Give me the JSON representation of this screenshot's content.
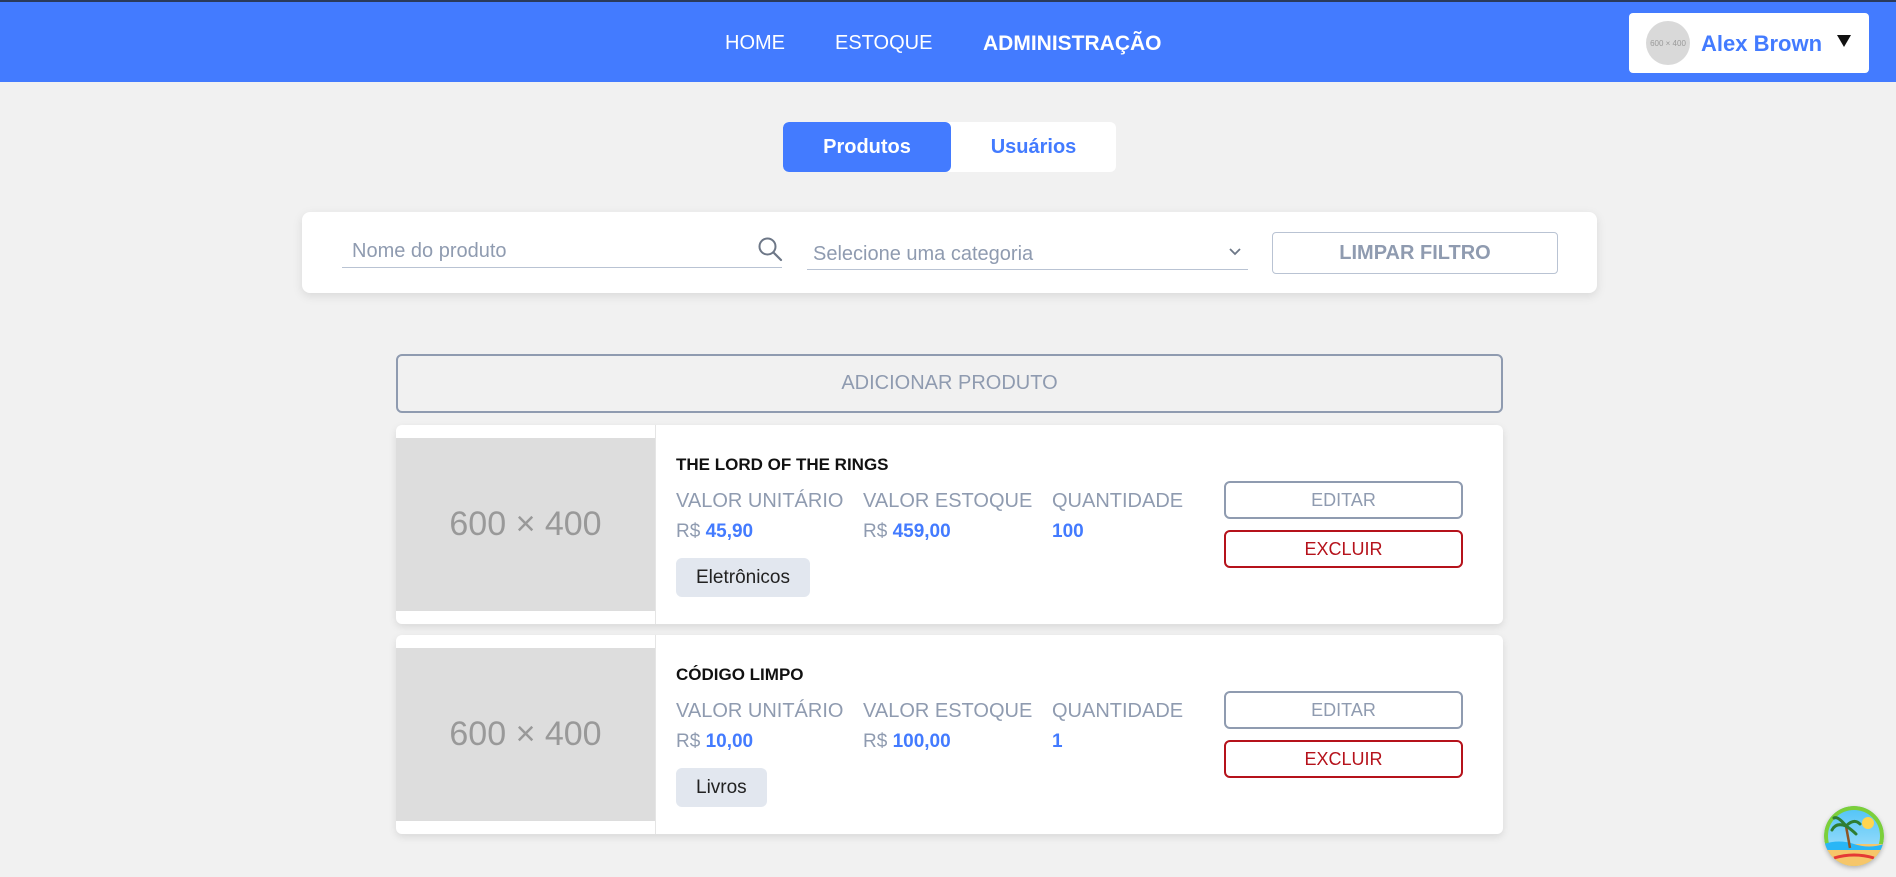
{
  "nav": {
    "links": [
      {
        "label": "HOME"
      },
      {
        "label": "ESTOQUE"
      },
      {
        "label": "ADMINISTRAÇÃO",
        "active": true
      }
    ]
  },
  "user": {
    "name": "Alex Brown",
    "avatar_placeholder": "600 × 400"
  },
  "tabs": [
    {
      "label": "Produtos",
      "active": true
    },
    {
      "label": "Usuários",
      "active": false
    }
  ],
  "filters": {
    "search_placeholder": "Nome do produto",
    "search_value": "",
    "category_placeholder": "Selecione uma categoria",
    "clear_label": "LIMPAR FILTRO"
  },
  "add_product_label": "ADICIONAR PRODUTO",
  "product_labels": {
    "unit_value": "VALOR UNITÁRIO",
    "stock_value": "VALOR ESTOQUE",
    "quantity": "QUANTIDADE",
    "currency": "R$",
    "edit": "EDITAR",
    "delete": "EXCLUIR"
  },
  "products": [
    {
      "image_placeholder": "600 × 400",
      "title": "THE LORD OF THE RINGS",
      "unit_value": "45,90",
      "stock_value": "459,00",
      "quantity": "100",
      "category": "Eletrônicos"
    },
    {
      "image_placeholder": "600 × 400",
      "title": "CÓDIGO LIMPO",
      "unit_value": "10,00",
      "stock_value": "100,00",
      "quantity": "1",
      "category": "Livros"
    }
  ],
  "colors": {
    "primary": "#437bff",
    "muted": "#8f9bb0",
    "danger": "#b5121b",
    "background": "#f1f1f1"
  },
  "icons": {
    "search": "search-icon",
    "dropdown": "chevron-down-icon",
    "user_menu": "caret-down-icon",
    "floating": "beach-avatar-icon"
  }
}
